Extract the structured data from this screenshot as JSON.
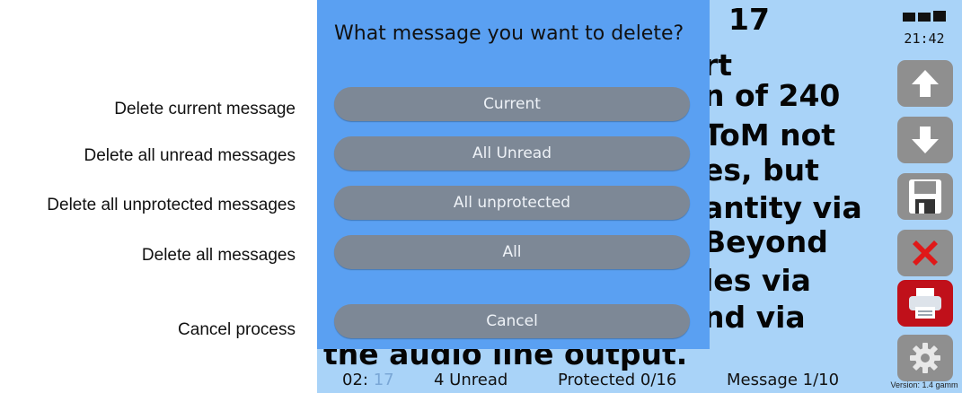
{
  "labels": {
    "current": "Delete current message",
    "unread": "Delete all unread messages",
    "unprotected": "Delete all unprotected messages",
    "all": "Delete all messages",
    "cancel": "Cancel process"
  },
  "message": {
    "lines": [
      "17",
      "rt",
      "n of 240",
      "ToM not",
      "es, but",
      "antity via",
      "Beyond",
      "les via",
      "nd via",
      "the audio line output."
    ]
  },
  "dialog": {
    "title": "What message you want to delete?",
    "buttons": {
      "current": "Current",
      "all_unread": "All Unread",
      "all_unprotected": "All unprotected",
      "all": "All",
      "cancel": "Cancel"
    }
  },
  "status": {
    "time_prefix": "02:",
    "time_faint": "17",
    "unread": "4  Unread",
    "protected": "Protected  0/16",
    "message": "Message  1/10"
  },
  "device": {
    "clock": "21:42",
    "version": "Version: 1.4 gamm"
  },
  "colors": {
    "device_bg": "#a9d3f8",
    "dialog_bg": "#5aa0f2",
    "button_bg": "#7d8896",
    "side_button": "#8f8f8f",
    "delete_red": "#e01818",
    "print_red": "#c0101a"
  },
  "icons": [
    "arrow-up-icon",
    "arrow-down-icon",
    "save-icon",
    "delete-icon",
    "print-icon",
    "settings-gear-icon",
    "signal-icon"
  ]
}
